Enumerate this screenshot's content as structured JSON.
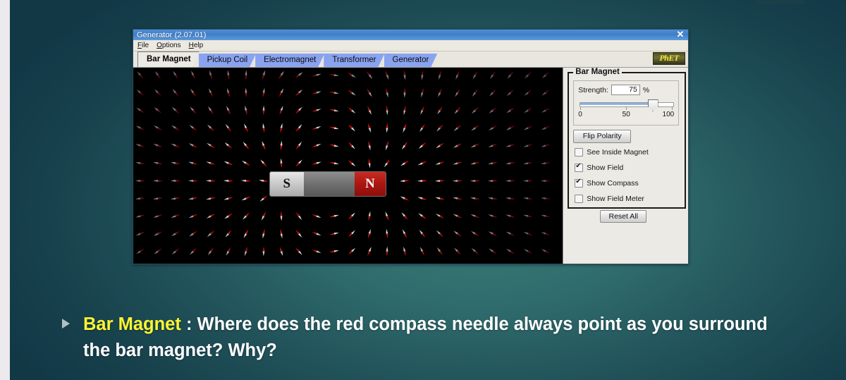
{
  "slide": {
    "background_color": "#2f6b6c",
    "caption": {
      "bullet": "triangle-bullet",
      "highlight": "Bar Magnet",
      "separator": " : ",
      "text": "Where does the red compass needle always point as you surround the bar magnet? Why?",
      "highlight_color": "#fbf432",
      "text_color": "#ffffff"
    }
  },
  "sim_window": {
    "title": "Generator (2.07.01)",
    "close_label": "✕",
    "menu": [
      {
        "label": "File",
        "accel": "F"
      },
      {
        "label": "Options",
        "accel": "O"
      },
      {
        "label": "Help",
        "accel": "H"
      }
    ],
    "tabs": [
      {
        "label": "Bar Magnet",
        "active": true
      },
      {
        "label": "Pickup Coil",
        "active": false
      },
      {
        "label": "Electromagnet",
        "active": false
      },
      {
        "label": "Transformer",
        "active": false
      },
      {
        "label": "Generator",
        "active": false
      }
    ],
    "logo": "PhET"
  },
  "play_area": {
    "background_color": "#000000",
    "magnet": {
      "south_label": "S",
      "north_label": "N",
      "south_color": "#c6c6c6",
      "north_color": "#a81510"
    },
    "compass": {
      "needle_north_color": "#cc1111",
      "needle_south_color": "#f0f0f0",
      "heading_degrees": 0
    },
    "field": {
      "grid_spacing_px": 25,
      "needle_color_north": "#cc1111",
      "needle_color_south": "#d9d9d9"
    }
  },
  "control_panel": {
    "group_title": "Bar Magnet",
    "strength": {
      "label": "Strength:",
      "value": "75",
      "unit": "%",
      "min_label": "0",
      "mid_label": "50",
      "max_label": "100",
      "slider_percent": 75
    },
    "flip_polarity_label": "Flip Polarity",
    "checkboxes": [
      {
        "label": "See Inside Magnet",
        "checked": false
      },
      {
        "label": "Show Field",
        "checked": true
      },
      {
        "label": "Show Compass",
        "checked": true
      },
      {
        "label": "Show Field Meter",
        "checked": false
      }
    ],
    "reset_all_label": "Reset All"
  }
}
